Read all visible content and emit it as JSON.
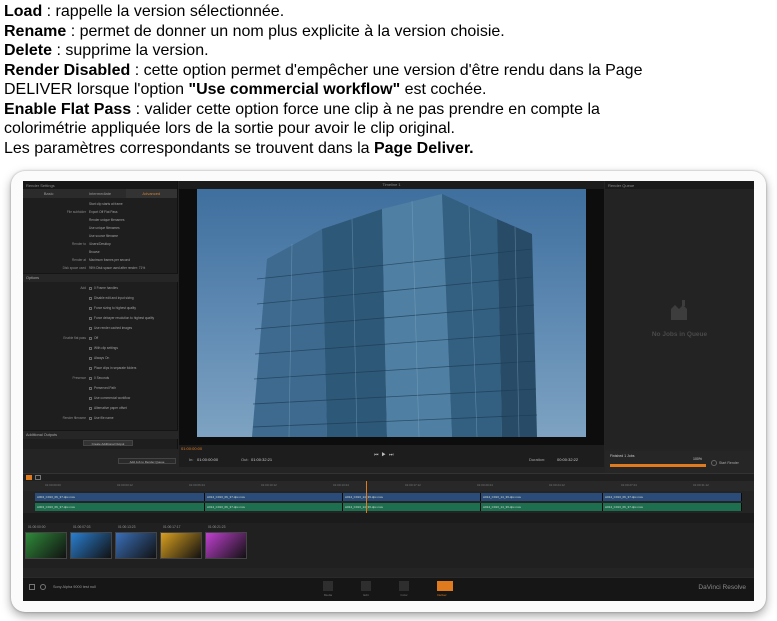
{
  "document": {
    "lines": [
      {
        "term": "Load",
        "text": " : rappelle la version sélectionnée."
      },
      {
        "term": "Rename",
        "text": " : permet de donner un nom plus explicite à la version choisie."
      },
      {
        "term": "Delete",
        "text": " : supprime la version."
      },
      {
        "term": "Render Disabled",
        "text": " : cette option permet d'empêcher une version d'être rendu dans la Page"
      },
      {
        "pre": "DELIVER lorsque l'option ",
        "term": "\"Use commercial workflow\"",
        "text": " est cochée."
      },
      {
        "term": "Enable Flat Pass",
        "text": " : valider cette option force une clip à ne pas prendre en compte la"
      },
      {
        "text": "colorimétrie appliquée lors de la sortie pour avoir le clip original."
      },
      {
        "pre": "Les paramètres correspondants se trouvent dans la ",
        "term": "Page Deliver."
      }
    ]
  },
  "app": {
    "settings": {
      "title": "Render Settings",
      "tabs": [
        "Basic",
        "Intermediate",
        "Advanced"
      ],
      "active_tab": 2,
      "rows": [
        {
          "label": "",
          "value": "Start clip starts at frame"
        },
        {
          "label": "File subfolder",
          "value": "Export Off Flat Pass"
        },
        {
          "label": "",
          "value": "Render unique filenames"
        },
        {
          "label": "",
          "value": "Use unique filenames"
        },
        {
          "label": "",
          "value": "Use source filename"
        },
        {
          "label": "Render to",
          "value": "/Users/Desktop"
        },
        {
          "label": "",
          "value": "Browse"
        },
        {
          "label": "Render at",
          "value": "Maximum     frames per second"
        },
        {
          "label": "Disk space used",
          "value": "96%   Disk space used after render: 71%"
        }
      ],
      "options_header": "Options",
      "option_rows": [
        {
          "label": "Add",
          "value": "0   Frame handles"
        },
        {
          "label": "",
          "value": "Disable edit and input sizing"
        },
        {
          "label": "",
          "value": "Force sizing to highest quality"
        },
        {
          "label": "",
          "value": "Force debayer resolution to highest quality"
        },
        {
          "label": "",
          "value": "Use render cached images"
        },
        {
          "label": "Enable flat pass",
          "value": "Off"
        },
        {
          "label": "",
          "value": "With clip settings"
        },
        {
          "label": "",
          "value": "Always On"
        },
        {
          "label": "",
          "value": "Place clips in separate folders"
        },
        {
          "label": "Presence",
          "value": "0   Seconds"
        },
        {
          "label": "",
          "value": "Preserved Path"
        },
        {
          "label": "",
          "value": "Use commercial workflow"
        },
        {
          "label": "",
          "value": "Alternative paper offset"
        },
        {
          "label": "Render filename",
          "value": "Use file name"
        }
      ],
      "additional_header": "Additional Outputs",
      "create_output_btn": "Create Additional Output",
      "add_job_btn": "Add Job to Render Queue"
    },
    "viewer": {
      "title": "Timeline 1",
      "tc_in_label": "In:",
      "tc_in": "01:00:00:00",
      "tc_out_label": "Out:",
      "tc_out": "01:00:32:21",
      "duration_label": "Duration:",
      "duration": "00:00:32:22",
      "timecode": "01:00:00:00"
    },
    "queue": {
      "title": "Render Queue",
      "empty_text": "No Jobs in Queue",
      "finished": "Finished 1 Jobs",
      "progress_pct": 100,
      "progress_label": "100%",
      "start_render": "Start Render"
    },
    "timeline": {
      "ruler_ticks": [
        "01:00:00:00",
        "01:00:03:12",
        "01:00:06:24",
        "01:00:10:12",
        "01:00:13:24",
        "01:00:17:12",
        "01:00:20:24",
        "01:00:24:12",
        "01:00:27:24",
        "01:00:31:12"
      ],
      "clips": [
        "A004_C013_06_37.dpx.mov",
        "A014_C013_06_37.dpx.mov",
        "A014_C013_14_36.dpx.mov",
        "A014_C013_14_36.dpx.mov",
        "A014_C013_06_37.dpx.mov"
      ]
    },
    "thumbnails": [
      {
        "tc": "01:00:00:00",
        "color": "#2f8a3a"
      },
      {
        "tc": "01:00:07:03",
        "color": "#2a7fd0"
      },
      {
        "tc": "01:00:13:23",
        "color": "#3a6fb8"
      },
      {
        "tc": "01:00:17:17",
        "color": "#d8a020"
      },
      {
        "tc": "01:00:21:23",
        "color": "#c040d0"
      }
    ],
    "bottom": {
      "project": "Sony Alpha 9000 test null",
      "pages": [
        "Media",
        "Edit",
        "Color",
        "Deliver"
      ],
      "active_page": 3,
      "brand": "DaVinci Resolve"
    }
  }
}
